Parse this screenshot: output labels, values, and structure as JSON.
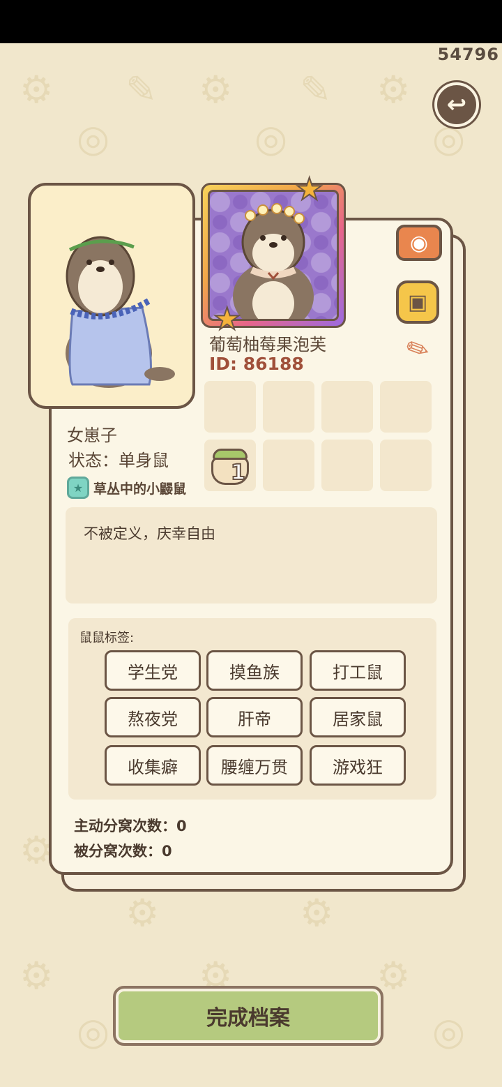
{
  "counter": "54796",
  "profile": {
    "nickname": "葡萄柚莓果泡芙",
    "id": "ID: 86188",
    "gender": "女崽子",
    "status": "状态：单身鼠",
    "title": "草丛中的小鼹鼠",
    "signature": "不被定义，庆幸自由",
    "item_count": "1"
  },
  "tags": {
    "label": "鼠鼠标签:",
    "items": [
      "学生党",
      "摸鱼族",
      "打工鼠",
      "熬夜党",
      "肝帝",
      "居家鼠",
      "收集癖",
      "腰缠万贯",
      "游戏狂"
    ]
  },
  "stats": {
    "active_split": "主动分窝次数：0",
    "passive_split": "被分窝次数：0"
  },
  "buttons": {
    "done": "完成档案",
    "back_icon": "back-arrow-icon",
    "camera_icon": "camera-icon",
    "frame_icon": "avatar-frame-icon",
    "edit_icon": "pencil-icon"
  },
  "colors": {
    "background": "#f1e7cc",
    "card": "#fbf6e6",
    "outline": "#6b5545",
    "done_button": "#b5ca7f"
  }
}
